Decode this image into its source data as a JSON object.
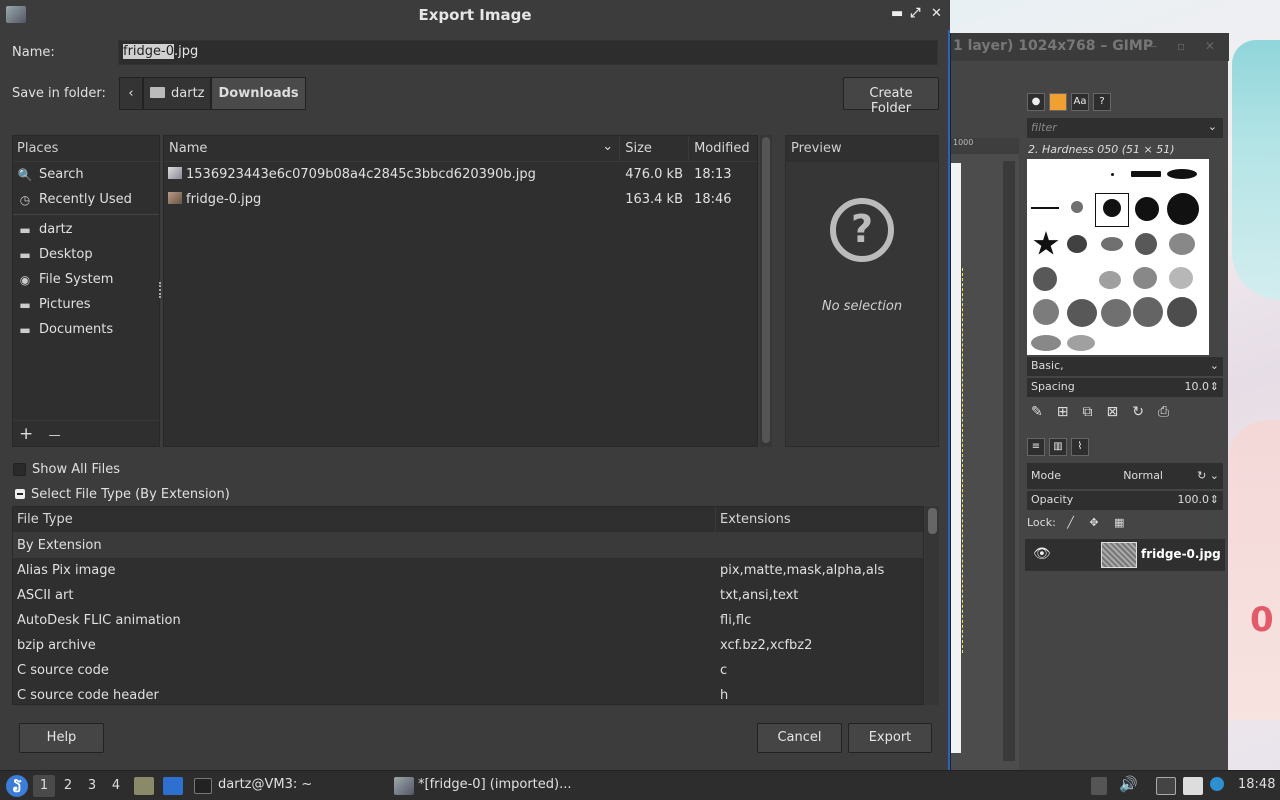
{
  "dialog": {
    "title": "Export Image",
    "name_label": "Name:",
    "name_selected": "fridge-0",
    "name_rest": ".jpg",
    "folder_label": "Save in folder:",
    "path": [
      "dartz",
      "Downloads"
    ],
    "create_folder": "Create Folder",
    "places_header": "Places",
    "places": [
      {
        "label": "Search",
        "icon": "search-icon"
      },
      {
        "label": "Recently Used",
        "icon": "clock-icon"
      },
      {
        "label": "dartz",
        "icon": "folder-icon"
      },
      {
        "label": "Desktop",
        "icon": "folder-icon"
      },
      {
        "label": "File System",
        "icon": "drive-icon"
      },
      {
        "label": "Pictures",
        "icon": "folder-icon"
      },
      {
        "label": "Documents",
        "icon": "folder-icon"
      }
    ],
    "places_add": "+",
    "places_remove": "—",
    "columns": {
      "name": "Name",
      "size": "Size",
      "modified": "Modified"
    },
    "files": [
      {
        "name": "1536923443e6c0709b08a4c2845c3bbcd620390b.jpg",
        "size": "476.0 kB",
        "modified": "18:13"
      },
      {
        "name": "fridge-0.jpg",
        "size": "163.4 kB",
        "modified": "18:46"
      }
    ],
    "preview_header": "Preview",
    "preview_empty": "No selection",
    "show_all_files": "Show All Files",
    "select_file_type": "Select File Type (By Extension)",
    "ft_columns": {
      "type": "File Type",
      "ext": "Extensions"
    },
    "file_types": [
      {
        "type": "By Extension",
        "ext": ""
      },
      {
        "type": "Alias Pix image",
        "ext": "pix,matte,mask,alpha,als"
      },
      {
        "type": "ASCII art",
        "ext": "txt,ansi,text"
      },
      {
        "type": "AutoDesk FLIC animation",
        "ext": "fli,flc"
      },
      {
        "type": "bzip archive",
        "ext": "xcf.bz2,xcfbz2"
      },
      {
        "type": "C source code",
        "ext": "c"
      },
      {
        "type": "C source code header",
        "ext": "h"
      }
    ],
    "help": "Help",
    "cancel": "Cancel",
    "export": "Export"
  },
  "gimp": {
    "title": "1 layer) 1024x768 – GIMP",
    "ruler_label": "1000",
    "filter_placeholder": "filter",
    "brush_name": "2. Hardness 050 (51 × 51)",
    "brush_set": "Basic,",
    "spacing_label": "Spacing",
    "spacing_value": "10.0",
    "mode_label": "Mode",
    "mode_value": "Normal",
    "opacity_label": "Opacity",
    "opacity_value": "100.0",
    "lock_label": "Lock:",
    "layer_name": "fridge-0.jpg"
  },
  "taskbar": {
    "workspaces": [
      "1",
      "2",
      "3",
      "4"
    ],
    "terminal_task": "dartz@VM3: ~",
    "gimp_task": "*[fridge-0] (imported)...",
    "clock": "18:48"
  },
  "colors": {
    "accent": "#2a64b8",
    "dialog_bg": "#3c3c3c",
    "panel_bg": "#2f2f2f"
  }
}
